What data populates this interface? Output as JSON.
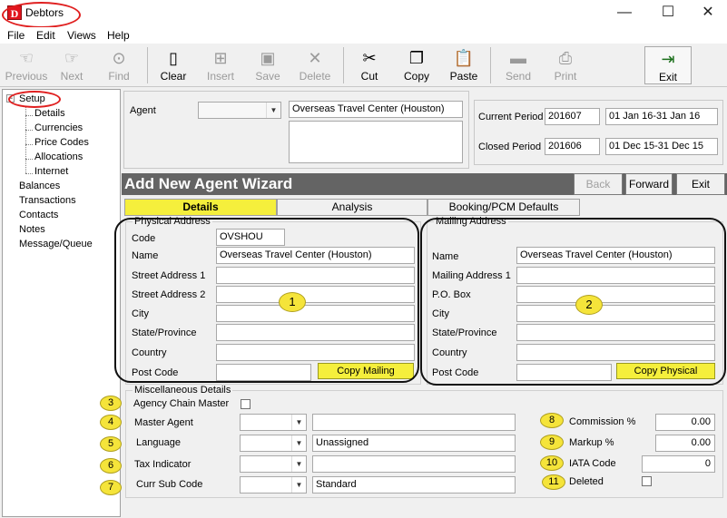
{
  "window": {
    "title": "Debtors",
    "app_icon": "D"
  },
  "menu": [
    "File",
    "Edit",
    "Views",
    "Help"
  ],
  "toolbar": [
    {
      "label": "Previous",
      "icon": "hand-point-left-icon",
      "glyph": "☜",
      "enabled": false
    },
    {
      "label": "Next",
      "icon": "hand-point-right-icon",
      "glyph": "☞",
      "enabled": false
    },
    {
      "label": "Find",
      "icon": "binoculars-icon",
      "glyph": "⊙",
      "enabled": false
    },
    {
      "label": "Clear",
      "icon": "blank-page-icon",
      "glyph": "▯",
      "enabled": true
    },
    {
      "label": "Insert",
      "icon": "insert-page-icon",
      "glyph": "⊞",
      "enabled": false
    },
    {
      "label": "Save",
      "icon": "floppy-icon",
      "glyph": "▣",
      "enabled": false
    },
    {
      "label": "Delete",
      "icon": "delete-x-icon",
      "glyph": "✕",
      "enabled": false
    },
    {
      "label": "Cut",
      "icon": "scissors-icon",
      "glyph": "✂",
      "enabled": true
    },
    {
      "label": "Copy",
      "icon": "copy-icon",
      "glyph": "❐",
      "enabled": true
    },
    {
      "label": "Paste",
      "icon": "clipboard-icon",
      "glyph": "📋",
      "enabled": true
    },
    {
      "label": "Send",
      "icon": "send-icon",
      "glyph": "▬",
      "enabled": false
    },
    {
      "label": "Print",
      "icon": "printer-icon",
      "glyph": "⎙",
      "enabled": false
    },
    {
      "label": "Exit",
      "icon": "exit-door-icon",
      "glyph": "⇥",
      "enabled": true
    }
  ],
  "tree": {
    "root": "Setup",
    "setup_children": [
      "Details",
      "Currencies",
      "Price Codes",
      "Allocations",
      "Internet"
    ],
    "others": [
      "Balances",
      "Transactions",
      "Contacts",
      "Notes",
      "Message/Queue"
    ]
  },
  "header": {
    "agent_label": "Agent",
    "agent_value": "",
    "agent_name": "Overseas Travel Center (Houston)",
    "current_period_label": "Current Period",
    "current_period": "201607",
    "current_range": "01 Jan 16-31 Jan 16",
    "closed_period_label": "Closed Period",
    "closed_period": "201606",
    "closed_range": "01 Dec 15-31 Dec 15"
  },
  "wizard": {
    "title": "Add New Agent Wizard",
    "back": "Back",
    "forward": "Forward",
    "exit": "Exit"
  },
  "tabs": [
    "Details",
    "Analysis",
    "Booking/PCM Defaults"
  ],
  "physical": {
    "title": "Physical Address",
    "code_label": "Code",
    "code": "OVSHOU",
    "name_label": "Name",
    "name": "Overseas Travel Center (Houston)",
    "street1_label": "Street Address 1",
    "street2_label": "Street Address 2",
    "city_label": "City",
    "state_label": "State/Province",
    "country_label": "Country",
    "postcode_label": "Post Code",
    "copy_button": "Copy Mailing"
  },
  "mailing": {
    "title": "Mailing Address",
    "name_label": "Name",
    "name": "Overseas Travel Center (Houston)",
    "address1_label": "Mailing Address 1",
    "pobox_label": "P.O. Box",
    "city_label": "City",
    "state_label": "State/Province",
    "country_label": "Country",
    "postcode_label": "Post Code",
    "copy_button": "Copy Physical"
  },
  "misc": {
    "title": "Miscellaneous Details",
    "agency_chain_label": "Agency Chain Master",
    "master_agent_label": "Master Agent",
    "language_label": "Language",
    "language_value": "Unassigned",
    "tax_label": "Tax Indicator",
    "curr_label": "Curr Sub Code",
    "curr_value": "Standard",
    "commission_label": "Commission %",
    "commission_value": "0.00",
    "markup_label": "Markup %",
    "markup_value": "0.00",
    "iata_label": "IATA Code",
    "iata_value": "0",
    "deleted_label": "Deleted"
  },
  "badges": [
    "1",
    "2",
    "3",
    "4",
    "5",
    "6",
    "7",
    "8",
    "9",
    "10",
    "11"
  ],
  "colors": {
    "highlight": "#f5ef3c",
    "wizard_bar": "#646464",
    "annotation_red": "#e02020"
  }
}
